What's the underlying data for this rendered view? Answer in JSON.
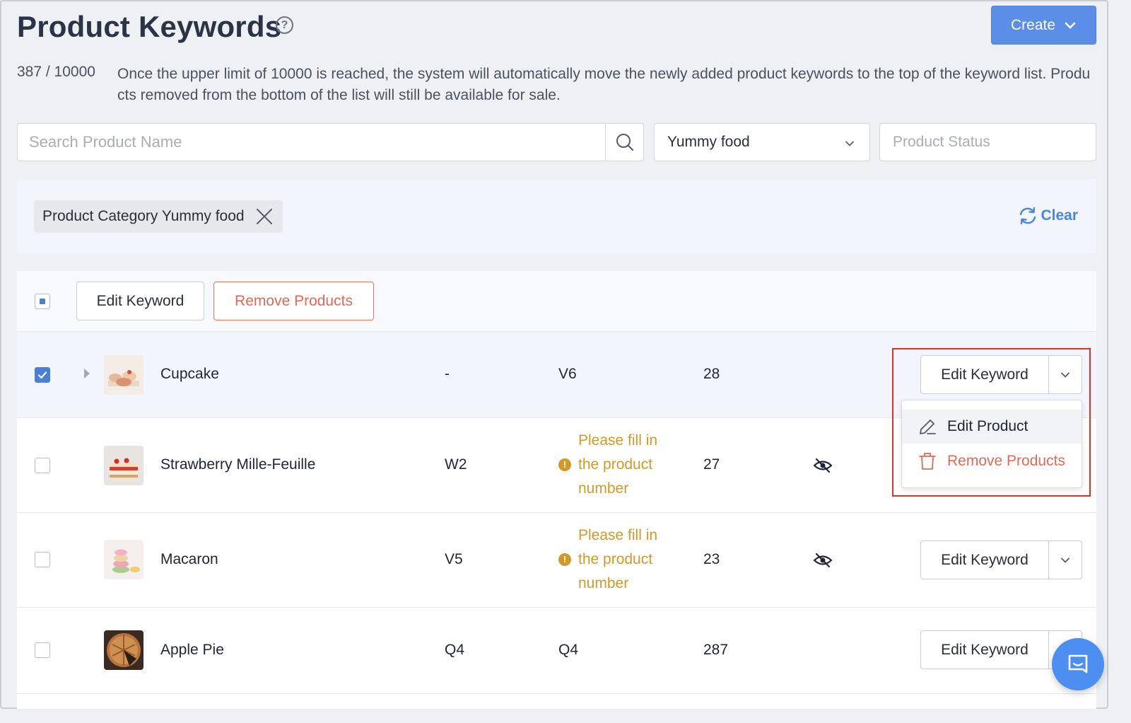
{
  "header": {
    "title": "Product Keywords",
    "help_icon": "question-circle-icon",
    "create_label": "Create"
  },
  "limit": {
    "count": "387 / 10000",
    "notice": "Once the upper limit of 10000 is reached, the system will automatically move the newly added product keywords to the top of the keyword list. Products removed from the bottom of the list will still be available for sale."
  },
  "filters": {
    "search_placeholder": "Search Product Name",
    "category_value": "Yummy food",
    "status_placeholder": "Product Status"
  },
  "active_filters": {
    "chip_label": "Product Category Yummy food",
    "clear_label": "Clear"
  },
  "toolbar": {
    "edit_keyword_label": "Edit Keyword",
    "remove_products_label": "Remove Products"
  },
  "rows": [
    {
      "name": "Cupcake",
      "col_a": "-",
      "col_b": "V6",
      "warning": "",
      "count": "28",
      "hidden": false,
      "checked": true,
      "action_label": "Edit Keyword"
    },
    {
      "name": "Strawberry Mille-Feuille",
      "col_a": "W2",
      "col_b": "",
      "warning": "Please fill in the product number",
      "count": "27",
      "hidden": true,
      "checked": false,
      "action_label": ""
    },
    {
      "name": "Macaron",
      "col_a": "V5",
      "col_b": "",
      "warning": "Please fill in the product number",
      "count": "23",
      "hidden": true,
      "checked": false,
      "action_label": "Edit Keyword"
    },
    {
      "name": "Apple Pie",
      "col_a": "Q4",
      "col_b": "Q4",
      "warning": "",
      "count": "287",
      "hidden": false,
      "checked": false,
      "action_label": "Edit Keyword"
    }
  ],
  "row_menu": {
    "edit_product_label": "Edit Product",
    "remove_products_label": "Remove Products"
  },
  "colors": {
    "accent": "#5b8ee6",
    "danger": "#e06a55",
    "warning": "#d09a2a",
    "highlight": "#e0302a"
  }
}
